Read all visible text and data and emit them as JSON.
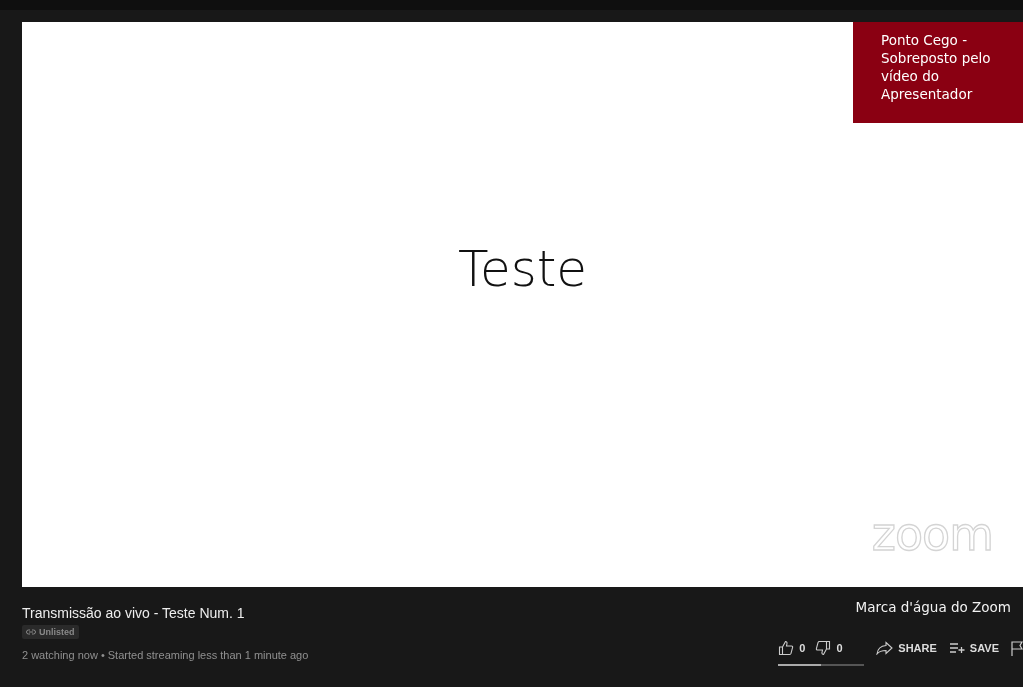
{
  "video": {
    "slide_text": "Teste",
    "watermark": "zoom",
    "overlay_note": "Ponto Cego - Sobreposto pelo vídeo do Apresentador"
  },
  "info": {
    "title": "Transmissão ao vivo - Teste Num. 1",
    "badge": "Unlisted",
    "meta": "2 watching now • Started streaming less than 1 minute ago",
    "watermark_note": "Marca d'água do Zoom"
  },
  "actions": {
    "likes": "0",
    "dislikes": "0",
    "share": "SHARE",
    "save": "SAVE",
    "sentiment": {
      "level": 0.5
    }
  }
}
